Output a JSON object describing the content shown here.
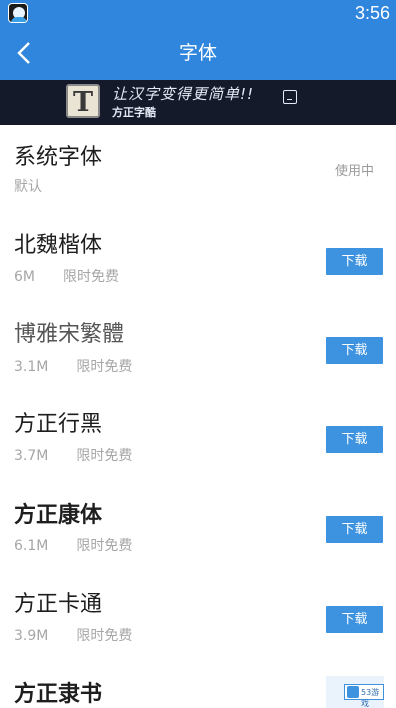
{
  "status_bar": {
    "time": "3:56"
  },
  "app_bar": {
    "title": "字体"
  },
  "banner": {
    "logo_letter": "T",
    "slogan": "让汉字变得更简单!!",
    "brand": "方正字酷"
  },
  "fonts": [
    {
      "name": "系统字体",
      "meta": "默认",
      "status": "使用中"
    },
    {
      "name": "北魏楷体",
      "size": "6M",
      "tag": "限时免费",
      "button": "下载"
    },
    {
      "name": "博雅宋繁體",
      "size": "3.1M",
      "tag": "限时免费",
      "button": "下载"
    },
    {
      "name": "方正行黑",
      "size": "3.7M",
      "tag": "限时免费",
      "button": "下载"
    },
    {
      "name": "方正康体",
      "size": "6.1M",
      "tag": "限时免费",
      "button": "下载"
    },
    {
      "name": "方正卡通",
      "size": "3.9M",
      "tag": "限时免费",
      "button": "下载"
    },
    {
      "name": "方正隶书"
    }
  ],
  "watermark": {
    "text": "53游戏"
  },
  "colors": {
    "primary": "#2f86dc",
    "button": "#3d93e0"
  }
}
